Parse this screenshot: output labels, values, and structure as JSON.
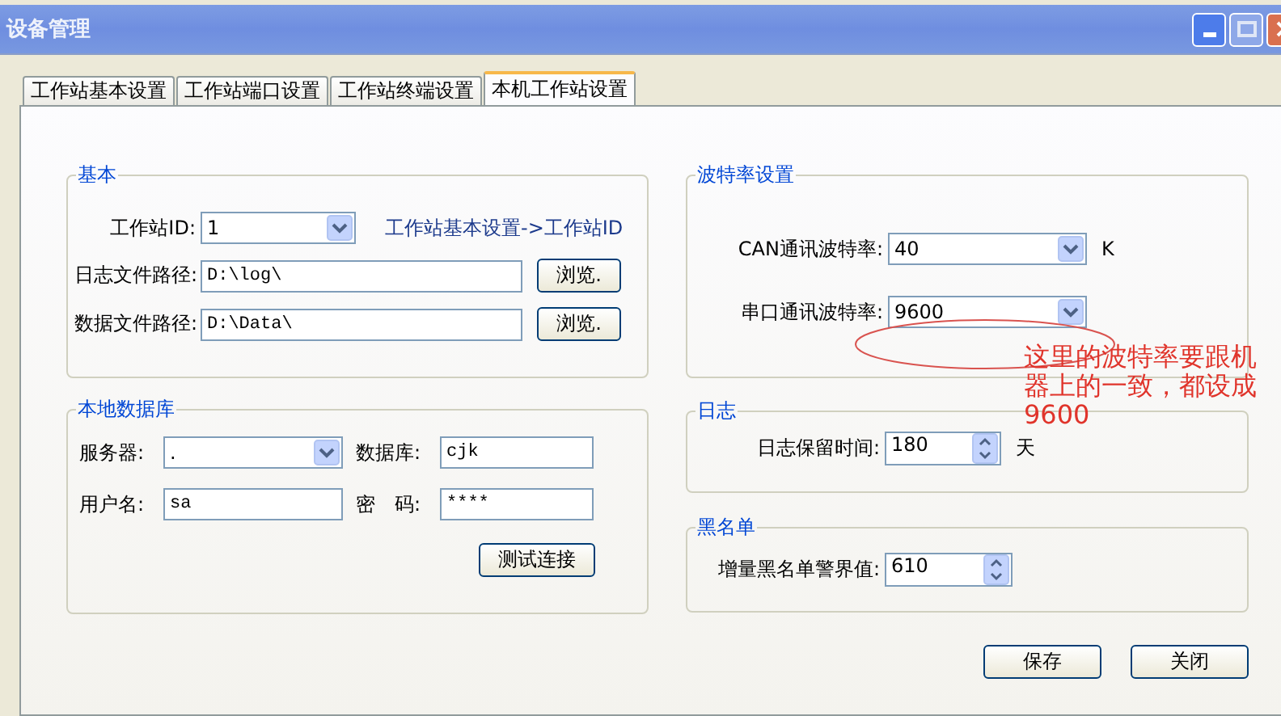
{
  "window": {
    "title": "设备管理"
  },
  "tabs": [
    {
      "label": "工作站基本设置",
      "selected": false
    },
    {
      "label": "工作站端口设置",
      "selected": false
    },
    {
      "label": "工作站终端设置",
      "selected": false
    },
    {
      "label": "本机工作站设置",
      "selected": true
    }
  ],
  "basic": {
    "title": "基本",
    "station_id": {
      "label": "工作站ID:",
      "value": "1",
      "hint": "工作站基本设置->工作站ID"
    },
    "log_path": {
      "label": "日志文件路径:",
      "value": "D:\\log\\",
      "button": "浏览."
    },
    "data_path": {
      "label": "数据文件路径:",
      "value": "D:\\Data\\",
      "button": "浏览."
    }
  },
  "database": {
    "title": "本地数据库",
    "server": {
      "label": "服务器:",
      "value": "."
    },
    "database": {
      "label": "数据库:",
      "value": "cjk"
    },
    "username": {
      "label": "用户名:",
      "value": "sa"
    },
    "password": {
      "label": "密　码:",
      "value": "****"
    },
    "test_button": "测试连接"
  },
  "baud": {
    "title": "波特率设置",
    "can": {
      "label": "CAN通讯波特率:",
      "value": "40",
      "unit": "K"
    },
    "serial": {
      "label": "串口通讯波特率:",
      "value": "9600"
    }
  },
  "log": {
    "title": "日志",
    "retention": {
      "label": "日志保留时间:",
      "value": "180",
      "unit": "天"
    }
  },
  "blacklist": {
    "title": "黑名单",
    "threshold": {
      "label": "增量黑名单警界值:",
      "value": "610"
    }
  },
  "buttons": [
    "保存",
    "关闭"
  ],
  "annotation": {
    "text": "这里的波特率要跟机器上的一致，都设成9600"
  }
}
